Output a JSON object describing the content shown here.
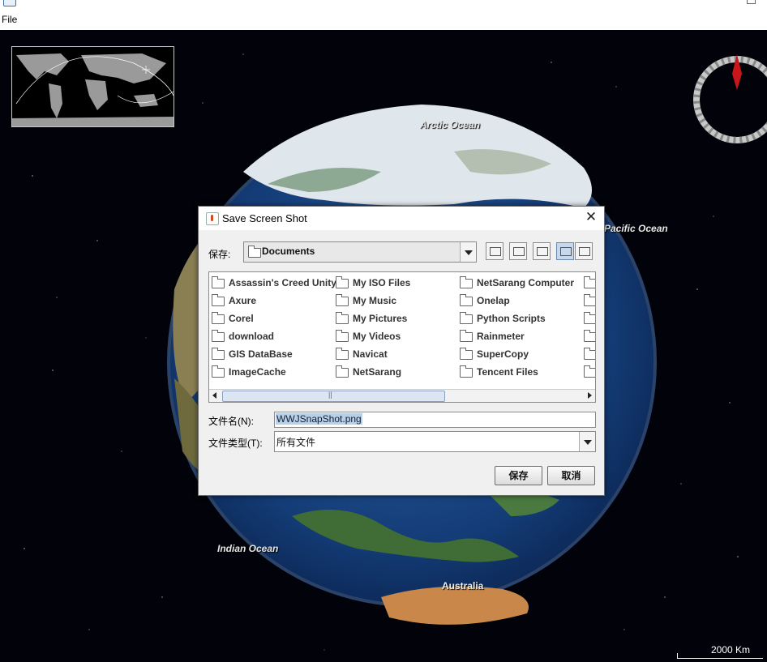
{
  "menubar": {
    "file_label": "File"
  },
  "map": {
    "labels": {
      "arctic": "Arctic Ocean",
      "pacific": "Pacific Ocean",
      "indian": "Indian Ocean",
      "australia": "Australia"
    },
    "scale_label": "2000 Km"
  },
  "dialog": {
    "title": "Save Screen Shot",
    "save_in_label": "保存:",
    "save_in_value": "Documents",
    "files": [
      [
        "Assassin's Creed Unity",
        "Axure",
        "Corel",
        "download",
        "GIS DataBase",
        "ImageCache"
      ],
      [
        "My ISO Files",
        "My Music",
        "My Pictures",
        "My Videos",
        "Navicat",
        "NetSarang"
      ],
      [
        "NetSarang Computer",
        "Onelap",
        "Python Scripts",
        "Rainmeter",
        "SuperCopy",
        "Tencent Files"
      ]
    ],
    "filename_label": "文件名(N):",
    "filename_value": "WWJSnapShot.png",
    "filetype_label": "文件类型(T):",
    "filetype_value": "所有文件",
    "save_button": "保存",
    "cancel_button": "取消"
  }
}
